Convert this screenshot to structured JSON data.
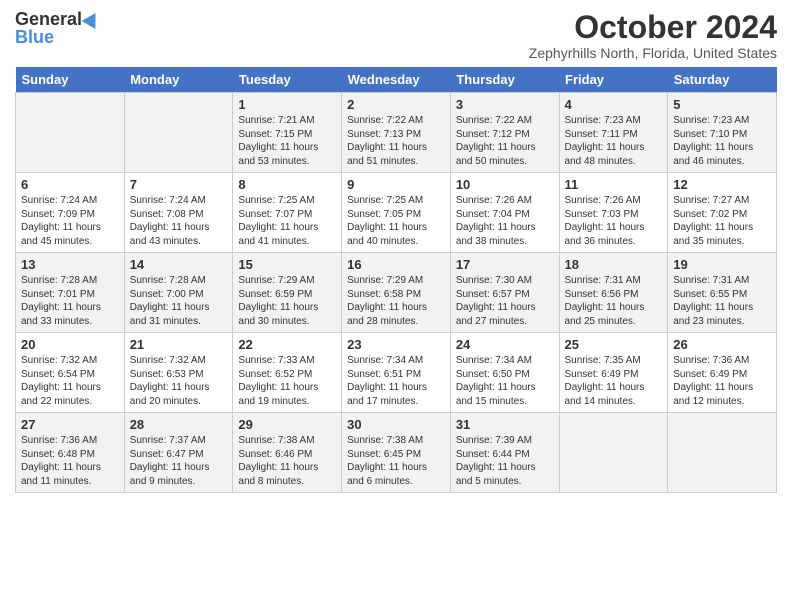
{
  "header": {
    "logo_general": "General",
    "logo_blue": "Blue",
    "month_title": "October 2024",
    "location": "Zephyrhills North, Florida, United States"
  },
  "days_of_week": [
    "Sunday",
    "Monday",
    "Tuesday",
    "Wednesday",
    "Thursday",
    "Friday",
    "Saturday"
  ],
  "weeks": [
    [
      {
        "day": "",
        "content": ""
      },
      {
        "day": "",
        "content": ""
      },
      {
        "day": "1",
        "content": "Sunrise: 7:21 AM\nSunset: 7:15 PM\nDaylight: 11 hours and 53 minutes."
      },
      {
        "day": "2",
        "content": "Sunrise: 7:22 AM\nSunset: 7:13 PM\nDaylight: 11 hours and 51 minutes."
      },
      {
        "day": "3",
        "content": "Sunrise: 7:22 AM\nSunset: 7:12 PM\nDaylight: 11 hours and 50 minutes."
      },
      {
        "day": "4",
        "content": "Sunrise: 7:23 AM\nSunset: 7:11 PM\nDaylight: 11 hours and 48 minutes."
      },
      {
        "day": "5",
        "content": "Sunrise: 7:23 AM\nSunset: 7:10 PM\nDaylight: 11 hours and 46 minutes."
      }
    ],
    [
      {
        "day": "6",
        "content": "Sunrise: 7:24 AM\nSunset: 7:09 PM\nDaylight: 11 hours and 45 minutes."
      },
      {
        "day": "7",
        "content": "Sunrise: 7:24 AM\nSunset: 7:08 PM\nDaylight: 11 hours and 43 minutes."
      },
      {
        "day": "8",
        "content": "Sunrise: 7:25 AM\nSunset: 7:07 PM\nDaylight: 11 hours and 41 minutes."
      },
      {
        "day": "9",
        "content": "Sunrise: 7:25 AM\nSunset: 7:05 PM\nDaylight: 11 hours and 40 minutes."
      },
      {
        "day": "10",
        "content": "Sunrise: 7:26 AM\nSunset: 7:04 PM\nDaylight: 11 hours and 38 minutes."
      },
      {
        "day": "11",
        "content": "Sunrise: 7:26 AM\nSunset: 7:03 PM\nDaylight: 11 hours and 36 minutes."
      },
      {
        "day": "12",
        "content": "Sunrise: 7:27 AM\nSunset: 7:02 PM\nDaylight: 11 hours and 35 minutes."
      }
    ],
    [
      {
        "day": "13",
        "content": "Sunrise: 7:28 AM\nSunset: 7:01 PM\nDaylight: 11 hours and 33 minutes."
      },
      {
        "day": "14",
        "content": "Sunrise: 7:28 AM\nSunset: 7:00 PM\nDaylight: 11 hours and 31 minutes."
      },
      {
        "day": "15",
        "content": "Sunrise: 7:29 AM\nSunset: 6:59 PM\nDaylight: 11 hours and 30 minutes."
      },
      {
        "day": "16",
        "content": "Sunrise: 7:29 AM\nSunset: 6:58 PM\nDaylight: 11 hours and 28 minutes."
      },
      {
        "day": "17",
        "content": "Sunrise: 7:30 AM\nSunset: 6:57 PM\nDaylight: 11 hours and 27 minutes."
      },
      {
        "day": "18",
        "content": "Sunrise: 7:31 AM\nSunset: 6:56 PM\nDaylight: 11 hours and 25 minutes."
      },
      {
        "day": "19",
        "content": "Sunrise: 7:31 AM\nSunset: 6:55 PM\nDaylight: 11 hours and 23 minutes."
      }
    ],
    [
      {
        "day": "20",
        "content": "Sunrise: 7:32 AM\nSunset: 6:54 PM\nDaylight: 11 hours and 22 minutes."
      },
      {
        "day": "21",
        "content": "Sunrise: 7:32 AM\nSunset: 6:53 PM\nDaylight: 11 hours and 20 minutes."
      },
      {
        "day": "22",
        "content": "Sunrise: 7:33 AM\nSunset: 6:52 PM\nDaylight: 11 hours and 19 minutes."
      },
      {
        "day": "23",
        "content": "Sunrise: 7:34 AM\nSunset: 6:51 PM\nDaylight: 11 hours and 17 minutes."
      },
      {
        "day": "24",
        "content": "Sunrise: 7:34 AM\nSunset: 6:50 PM\nDaylight: 11 hours and 15 minutes."
      },
      {
        "day": "25",
        "content": "Sunrise: 7:35 AM\nSunset: 6:49 PM\nDaylight: 11 hours and 14 minutes."
      },
      {
        "day": "26",
        "content": "Sunrise: 7:36 AM\nSunset: 6:49 PM\nDaylight: 11 hours and 12 minutes."
      }
    ],
    [
      {
        "day": "27",
        "content": "Sunrise: 7:36 AM\nSunset: 6:48 PM\nDaylight: 11 hours and 11 minutes."
      },
      {
        "day": "28",
        "content": "Sunrise: 7:37 AM\nSunset: 6:47 PM\nDaylight: 11 hours and 9 minutes."
      },
      {
        "day": "29",
        "content": "Sunrise: 7:38 AM\nSunset: 6:46 PM\nDaylight: 11 hours and 8 minutes."
      },
      {
        "day": "30",
        "content": "Sunrise: 7:38 AM\nSunset: 6:45 PM\nDaylight: 11 hours and 6 minutes."
      },
      {
        "day": "31",
        "content": "Sunrise: 7:39 AM\nSunset: 6:44 PM\nDaylight: 11 hours and 5 minutes."
      },
      {
        "day": "",
        "content": ""
      },
      {
        "day": "",
        "content": ""
      }
    ]
  ]
}
